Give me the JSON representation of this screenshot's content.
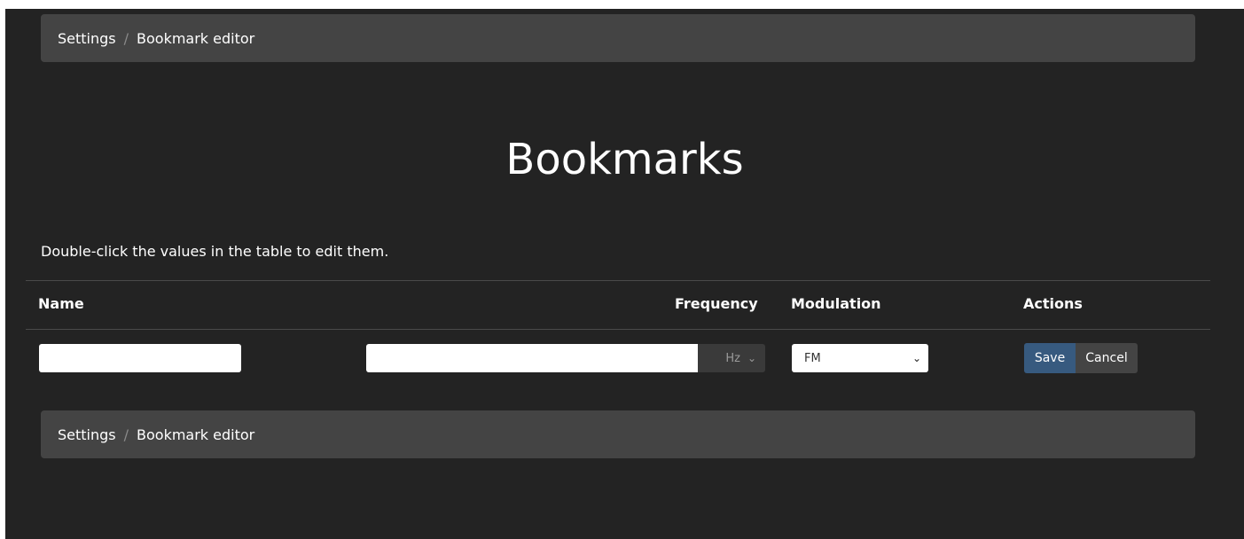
{
  "breadcrumb": {
    "parent": "Settings",
    "separator": "/",
    "current": "Bookmark editor"
  },
  "page_title": "Bookmarks",
  "hint": "Double-click the values in the table to edit them.",
  "table": {
    "headers": {
      "name": "Name",
      "frequency": "Frequency",
      "modulation": "Modulation",
      "actions": "Actions"
    },
    "edit_row": {
      "name_value": "",
      "frequency_value": "",
      "unit_selected": "Hz",
      "modulation_selected": "FM",
      "save_label": "Save",
      "cancel_label": "Cancel"
    }
  },
  "footer_breadcrumb": {
    "parent": "Settings",
    "separator": "/",
    "current": "Bookmark editor"
  },
  "colors": {
    "background": "#232323",
    "panel": "#444444",
    "primary": "#375a7f",
    "text": "#ffffff"
  },
  "icons": {
    "dropdown": "chevron-down-icon"
  }
}
